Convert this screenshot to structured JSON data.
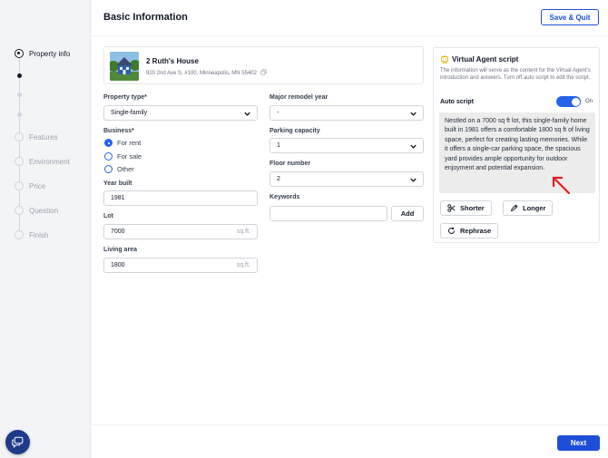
{
  "header": {
    "title": "Basic Information",
    "save_label": "Save & Quit"
  },
  "sidebar": {
    "steps": [
      {
        "label": "Property info",
        "active": true
      },
      {
        "label": "Features"
      },
      {
        "label": "Environment"
      },
      {
        "label": "Price"
      },
      {
        "label": "Question"
      },
      {
        "label": "Finish"
      }
    ]
  },
  "property": {
    "name": "2 Ruth's House",
    "address": "920 2nd Ave S, #100, Minneapolis, MN 55402"
  },
  "form": {
    "property_type": {
      "label": "Property type*",
      "value": "Single-family"
    },
    "business": {
      "label": "Business*",
      "options": [
        "For rent",
        "For sale",
        "Other"
      ],
      "selected": "For rent"
    },
    "year_built": {
      "label": "Year built",
      "value": "1981"
    },
    "lot": {
      "label": "Lot",
      "value": "7000",
      "unit": "sq.ft."
    },
    "living_area": {
      "label": "Living area",
      "value": "1800",
      "unit": "sq.ft."
    },
    "major_remodel_year": {
      "label": "Major remodel year",
      "value": "-"
    },
    "parking_capacity": {
      "label": "Parking capacity",
      "value": "1"
    },
    "floor_number": {
      "label": "Floor number",
      "value": "2"
    },
    "keywords": {
      "label": "Keywords",
      "value": "",
      "add_label": "Add"
    }
  },
  "virtual_agent": {
    "title": "Virtual Agent script",
    "description": "The information will serve as the content for the Virtual Agent's introduction and answers. Turn off auto script to edit the script.",
    "auto_script_label": "Auto script",
    "toggle_state": "On",
    "script": "Nestled on a 7000 sq ft lot, this single-family home built in 1981 offers a comfortable 1800 sq ft of living space, perfect for creating lasting memories. While it offers a single-car parking space, the spacious yard provides ample opportunity for outdoor enjoyment and potential expansion.",
    "actions": {
      "shorter": "Shorter",
      "longer": "Longer",
      "rephrase": "Rephrase"
    }
  },
  "footer": {
    "next_label": "Next"
  },
  "colors": {
    "accent": "#1d4ed8",
    "annotation_arrow": "#e11d1d"
  }
}
